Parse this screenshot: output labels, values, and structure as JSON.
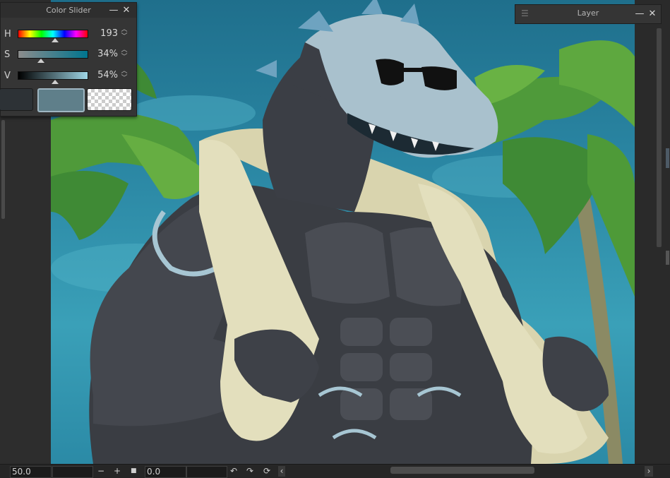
{
  "color_slider": {
    "title": "Color Slider",
    "minimize_glyph": "—",
    "close_glyph": "✕",
    "rows": [
      {
        "label": "H",
        "value": "193",
        "level": 0.536
      },
      {
        "label": "S",
        "value": "34%",
        "level": 0.34
      },
      {
        "label": "V",
        "value": "54%",
        "level": 0.54
      }
    ],
    "spin_glyph_up": "︿",
    "spin_glyph_down": "﹀",
    "swatches": [
      {
        "name": "main-color",
        "color": "#2d3236"
      },
      {
        "name": "sub-color",
        "color": "#5f7f8a"
      },
      {
        "name": "transparent-color",
        "color": "transparent"
      }
    ],
    "accent_color": "#6f93a5"
  },
  "layer_panel": {
    "title": "Layer",
    "menu_icon": "hamburger-icon",
    "minimize_glyph": "—",
    "close_glyph": "✕"
  },
  "status_bar": {
    "zoom": "50.0",
    "zoom_out": "−",
    "zoom_in": "+",
    "stop": "■",
    "rotation": "0.0",
    "rotate_left": "↶",
    "rotate_right": "↷",
    "reset": "⟳",
    "scroll_left": "‹",
    "scroll_right": "›"
  }
}
